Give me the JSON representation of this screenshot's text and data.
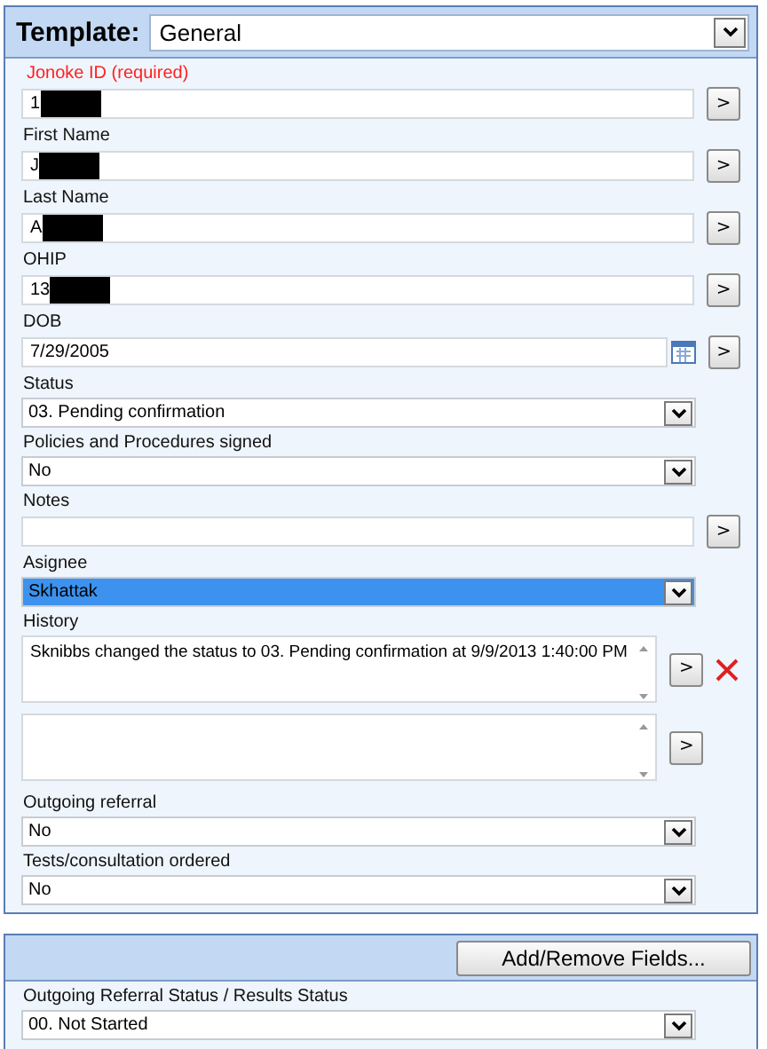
{
  "template": {
    "label": "Template:",
    "value": "General"
  },
  "fields": [
    {
      "kind": "text",
      "label": "Jonoke ID (required)",
      "required": true,
      "value": "1",
      "redacted": true,
      "go_button": ">"
    },
    {
      "kind": "text",
      "label": "First Name",
      "required": false,
      "value": "J",
      "redacted": true,
      "go_button": ">"
    },
    {
      "kind": "text",
      "label": "Last Name",
      "required": false,
      "value": "A",
      "redacted": true,
      "go_button": ">"
    },
    {
      "kind": "text",
      "label": "OHIP",
      "required": false,
      "value": "13",
      "redacted": true,
      "go_button": ">"
    },
    {
      "kind": "date",
      "label": "DOB",
      "required": false,
      "value": "7/29/2005",
      "redacted": false,
      "go_button": ">"
    },
    {
      "kind": "select",
      "label": "Status",
      "required": false,
      "value": "03. Pending confirmation",
      "selected": false
    },
    {
      "kind": "select",
      "label": "Policies and Procedures signed",
      "required": false,
      "value": "No",
      "selected": false
    },
    {
      "kind": "text",
      "label": "Notes",
      "required": false,
      "redacted": false,
      "go_button": ">"
    },
    {
      "kind": "select",
      "label": "Asignee",
      "required": false,
      "value": "Skhattak",
      "selected": true
    },
    {
      "kind": "textarea",
      "label": "History",
      "required": false,
      "value": "Sknibbs changed the status to 03. Pending confirmation at 9/9/2013 1:40:00 PM",
      "go_button": ">",
      "deletable": true
    },
    {
      "kind": "textarea",
      "go_button": ">",
      "deletable": false
    },
    {
      "kind": "select",
      "label": "Outgoing referral",
      "required": false,
      "value": "No",
      "selected": false
    },
    {
      "kind": "select",
      "label": "Tests/consultation ordered",
      "required": false,
      "value": "No",
      "selected": false
    }
  ],
  "lower_panel": {
    "button": "Add/Remove Fields...",
    "fields": [
      {
        "kind": "select",
        "label": "Outgoing Referral Status / Results Status",
        "required": false,
        "value": "00. Not Started",
        "selected": false
      }
    ]
  }
}
